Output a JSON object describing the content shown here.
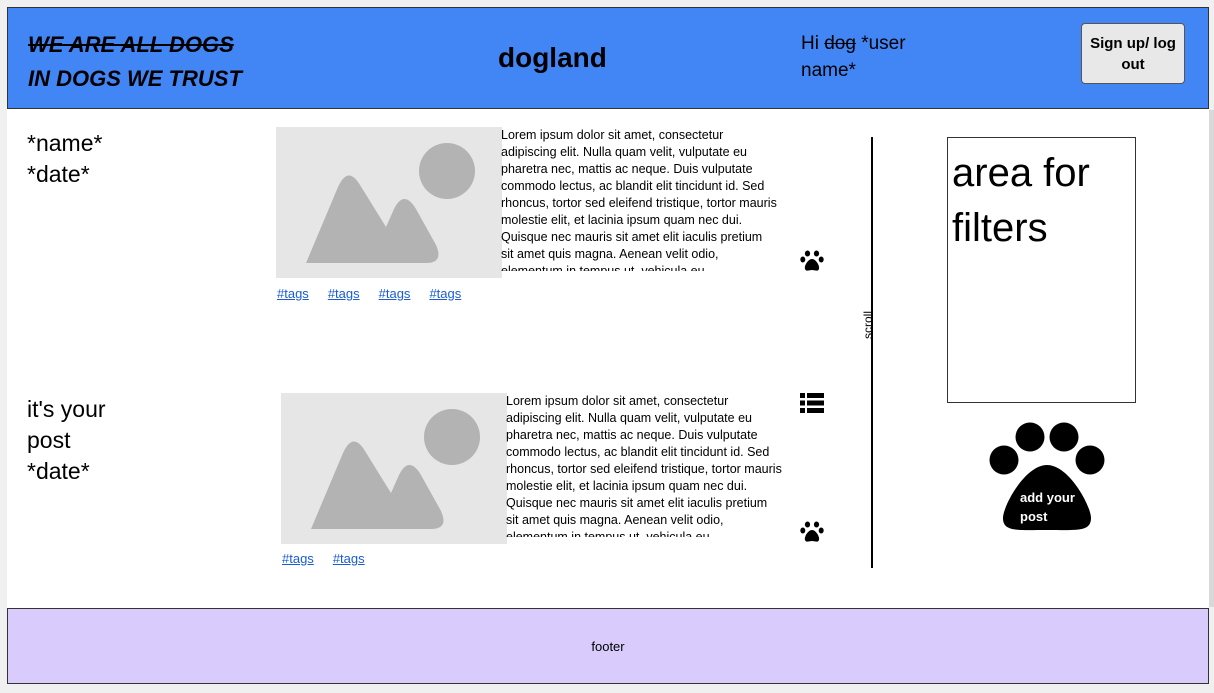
{
  "header": {
    "slogan_struck": "WE ARE ALL DOGS",
    "slogan_line2": "IN DOGS WE TRUST",
    "brand": "dogland",
    "greeting_hi": "Hi",
    "greeting_dog": "dog",
    "greeting_user": "*user name*",
    "auth_button": "Sign up/ log out",
    "bg_color": "#4285f4"
  },
  "posts": [
    {
      "author": "*name*",
      "date": "*date*",
      "text": "Lorem ipsum dolor sit amet, consectetur adipiscing elit. Nulla quam velit, vulputate eu pharetra nec, mattis ac neque. Duis vulputate commodo lectus, ac blandit elit tincidunt id. Sed rhoncus, tortor sed eleifend tristique, tortor mauris molestie elit, et lacinia ipsum quam nec dui. Quisque nec mauris sit amet elit iaculis pretium sit amet quis magna. Aenean velit odio, elementum in tempus ut, vehicula eu",
      "tags": [
        "#tags",
        "#tags",
        "#tags",
        "#tags"
      ],
      "like_icon": "paw-icon"
    },
    {
      "author_line1": "it's your",
      "author_line2": "post",
      "date": "*date*",
      "text": "Lorem ipsum dolor sit amet, consectetur adipiscing elit. Nulla quam velit, vulputate eu pharetra nec, mattis ac neque. Duis vulputate commodo lectus, ac blandit elit tincidunt id. Sed rhoncus, tortor sed eleifend tristique, tortor mauris molestie elit, et lacinia ipsum quam nec dui. Quisque nec mauris sit amet elit iaculis pretium sit amet quis magna. Aenean velit odio, elementum in tempus ut, vehicula eu",
      "tags": [
        "#tags",
        "#tags"
      ],
      "menu_icon": "list-menu-icon",
      "like_icon": "paw-icon"
    }
  ],
  "scroll_label": "scroll",
  "filters": {
    "label": "area for filters"
  },
  "add_post": {
    "label": "add your post",
    "icon": "paw-icon"
  },
  "footer": {
    "label": "footer",
    "bg_color": "#d9ccfd"
  }
}
